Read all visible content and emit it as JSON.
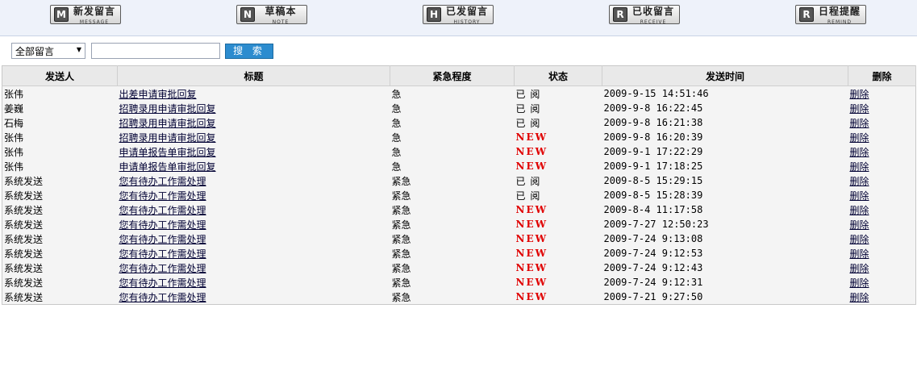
{
  "toolbar": [
    {
      "letter": "M",
      "cn": "新发留言",
      "en": "MESSAGE"
    },
    {
      "letter": "N",
      "cn": "草稿本",
      "en": "NOTE"
    },
    {
      "letter": "H",
      "cn": "已发留言",
      "en": "HISTORY"
    },
    {
      "letter": "R",
      "cn": "已收留言",
      "en": "RECEIVE"
    },
    {
      "letter": "R",
      "cn": "日程提醒",
      "en": "REMIND"
    }
  ],
  "search": {
    "filter_value": "全部留言",
    "input_value": "",
    "button_label": "搜 索"
  },
  "table": {
    "headers": [
      "发送人",
      "标题",
      "紧急程度",
      "状态",
      "发送时间",
      "删除"
    ],
    "rows": [
      {
        "sender": "张伟",
        "title": "出差申请审批回复",
        "urgency": "急",
        "status": "已 阅",
        "status_new": false,
        "time": "2009-9-15 14:51:46",
        "delete": "删除"
      },
      {
        "sender": "姜巍",
        "title": "招聘录用申请审批回复",
        "urgency": "急",
        "status": "已 阅",
        "status_new": false,
        "time": "2009-9-8 16:22:45",
        "delete": "删除"
      },
      {
        "sender": "石梅",
        "title": "招聘录用申请审批回复",
        "urgency": "急",
        "status": "已 阅",
        "status_new": false,
        "time": "2009-9-8 16:21:38",
        "delete": "删除"
      },
      {
        "sender": "张伟",
        "title": "招聘录用申请审批回复",
        "urgency": "急",
        "status": "NEW",
        "status_new": true,
        "time": "2009-9-8 16:20:39",
        "delete": "删除"
      },
      {
        "sender": "张伟",
        "title": "申请单报告单审批回复",
        "urgency": "急",
        "status": "NEW",
        "status_new": true,
        "time": "2009-9-1 17:22:29",
        "delete": "删除"
      },
      {
        "sender": "张伟",
        "title": "申请单报告单审批回复",
        "urgency": "急",
        "status": "NEW",
        "status_new": true,
        "time": "2009-9-1 17:18:25",
        "delete": "删除"
      },
      {
        "sender": "系统发送",
        "title": "您有待办工作需处理",
        "urgency": "紧急",
        "status": "已 阅",
        "status_new": false,
        "time": "2009-8-5 15:29:15",
        "delete": "删除"
      },
      {
        "sender": "系统发送",
        "title": "您有待办工作需处理",
        "urgency": "紧急",
        "status": "已 阅",
        "status_new": false,
        "time": "2009-8-5 15:28:39",
        "delete": "删除"
      },
      {
        "sender": "系统发送",
        "title": "您有待办工作需处理",
        "urgency": "紧急",
        "status": "NEW",
        "status_new": true,
        "time": "2009-8-4 11:17:58",
        "delete": "删除"
      },
      {
        "sender": "系统发送",
        "title": "您有待办工作需处理",
        "urgency": "紧急",
        "status": "NEW",
        "status_new": true,
        "time": "2009-7-27 12:50:23",
        "delete": "删除"
      },
      {
        "sender": "系统发送",
        "title": "您有待办工作需处理",
        "urgency": "紧急",
        "status": "NEW",
        "status_new": true,
        "time": "2009-7-24 9:13:08",
        "delete": "删除"
      },
      {
        "sender": "系统发送",
        "title": "您有待办工作需处理",
        "urgency": "紧急",
        "status": "NEW",
        "status_new": true,
        "time": "2009-7-24 9:12:53",
        "delete": "删除"
      },
      {
        "sender": "系统发送",
        "title": "您有待办工作需处理",
        "urgency": "紧急",
        "status": "NEW",
        "status_new": true,
        "time": "2009-7-24 9:12:43",
        "delete": "删除"
      },
      {
        "sender": "系统发送",
        "title": "您有待办工作需处理",
        "urgency": "紧急",
        "status": "NEW",
        "status_new": true,
        "time": "2009-7-24 9:12:31",
        "delete": "删除"
      },
      {
        "sender": "系统发送",
        "title": "您有待办工作需处理",
        "urgency": "紧急",
        "status": "NEW",
        "status_new": true,
        "time": "2009-7-21 9:27:50",
        "delete": "删除"
      }
    ]
  },
  "colors": {
    "new_status": "#e00000",
    "search_button": "#2c8ccf",
    "toolbar_bg": "#eef2fa"
  }
}
